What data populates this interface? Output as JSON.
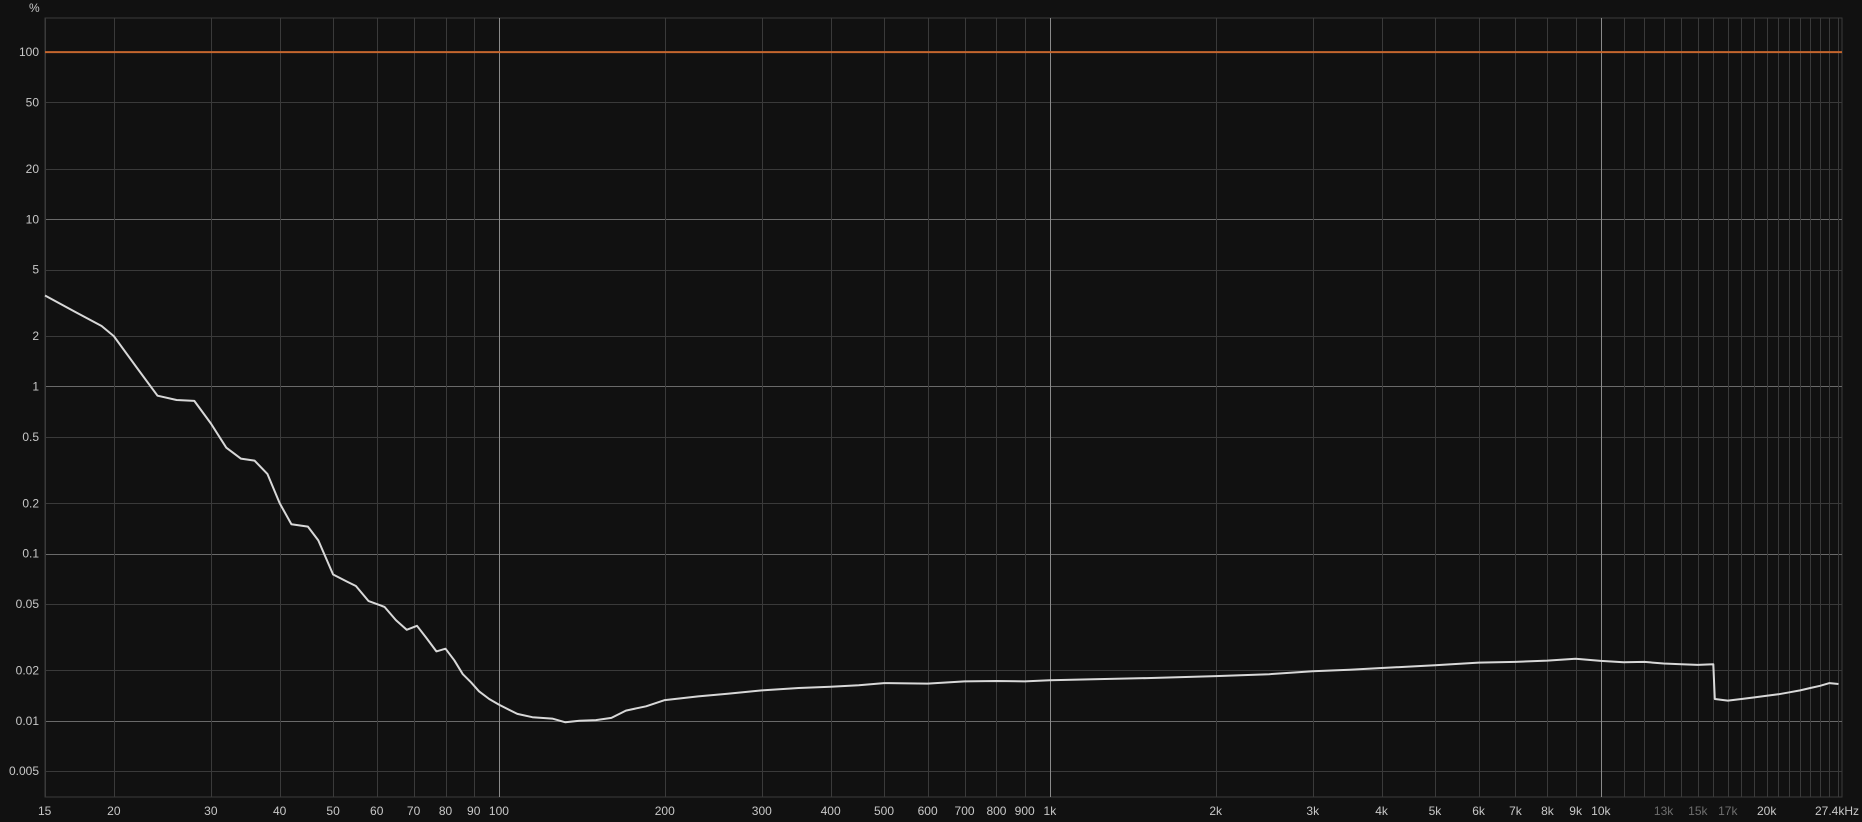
{
  "chart_data": {
    "type": "line",
    "y_unit_label": "%",
    "y_scale": "log",
    "x_scale": "log",
    "x_unit": "Hz",
    "xlim": [
      15,
      27400
    ],
    "ylim": [
      0.0035,
      160
    ],
    "grid": true,
    "colors": {
      "background": "#111111",
      "grid_major": "#6a6a6a",
      "grid_minor": "#3a3a3a",
      "reference_line": "#c4662e",
      "series": "#d8d8d8"
    },
    "y_ticks": [
      {
        "value": 100,
        "label": "100"
      },
      {
        "value": 50,
        "label": "50"
      },
      {
        "value": 20,
        "label": "20"
      },
      {
        "value": 10,
        "label": "10"
      },
      {
        "value": 5,
        "label": "5"
      },
      {
        "value": 2,
        "label": "2"
      },
      {
        "value": 1,
        "label": "1"
      },
      {
        "value": 0.5,
        "label": "0.5"
      },
      {
        "value": 0.2,
        "label": "0.2"
      },
      {
        "value": 0.1,
        "label": "0.1"
      },
      {
        "value": 0.05,
        "label": "0.05"
      },
      {
        "value": 0.02,
        "label": "0.02"
      },
      {
        "value": 0.01,
        "label": "0.01"
      },
      {
        "value": 0.005,
        "label": "0.005"
      }
    ],
    "x_ticks": [
      {
        "value": 15,
        "label": "15",
        "dim": false
      },
      {
        "value": 20,
        "label": "20",
        "dim": false
      },
      {
        "value": 30,
        "label": "30",
        "dim": false
      },
      {
        "value": 40,
        "label": "40",
        "dim": false
      },
      {
        "value": 50,
        "label": "50",
        "dim": false
      },
      {
        "value": 60,
        "label": "60",
        "dim": false
      },
      {
        "value": 70,
        "label": "70",
        "dim": false
      },
      {
        "value": 80,
        "label": "80",
        "dim": false
      },
      {
        "value": 90,
        "label": "90",
        "dim": false
      },
      {
        "value": 100,
        "label": "100",
        "dim": false
      },
      {
        "value": 200,
        "label": "200",
        "dim": false
      },
      {
        "value": 300,
        "label": "300",
        "dim": false
      },
      {
        "value": 400,
        "label": "400",
        "dim": false
      },
      {
        "value": 500,
        "label": "500",
        "dim": false
      },
      {
        "value": 600,
        "label": "600",
        "dim": false
      },
      {
        "value": 700,
        "label": "700",
        "dim": false
      },
      {
        "value": 800,
        "label": "800",
        "dim": false
      },
      {
        "value": 900,
        "label": "900",
        "dim": false
      },
      {
        "value": 1000,
        "label": "1k",
        "dim": false
      },
      {
        "value": 2000,
        "label": "2k",
        "dim": false
      },
      {
        "value": 3000,
        "label": "3k",
        "dim": false
      },
      {
        "value": 4000,
        "label": "4k",
        "dim": false
      },
      {
        "value": 5000,
        "label": "5k",
        "dim": false
      },
      {
        "value": 6000,
        "label": "6k",
        "dim": false
      },
      {
        "value": 7000,
        "label": "7k",
        "dim": false
      },
      {
        "value": 8000,
        "label": "8k",
        "dim": false
      },
      {
        "value": 9000,
        "label": "9k",
        "dim": false
      },
      {
        "value": 10000,
        "label": "10k",
        "dim": false
      },
      {
        "value": 13000,
        "label": "13k",
        "dim": true
      },
      {
        "value": 15000,
        "label": "15k",
        "dim": true
      },
      {
        "value": 17000,
        "label": "17k",
        "dim": true
      },
      {
        "value": 20000,
        "label": "20k",
        "dim": false
      },
      {
        "value": 27400,
        "label": "27.4kHz",
        "dim": false
      }
    ],
    "x_major_lines": [
      100,
      1000,
      10000
    ],
    "x_grid_lines": [
      15,
      20,
      30,
      40,
      50,
      60,
      70,
      80,
      90,
      100,
      200,
      300,
      400,
      500,
      600,
      700,
      800,
      900,
      1000,
      2000,
      3000,
      4000,
      5000,
      6000,
      7000,
      8000,
      9000,
      10000,
      11000,
      12000,
      13000,
      14000,
      15000,
      16000,
      17000,
      18000,
      19000,
      20000,
      21000,
      22000,
      23000,
      24000,
      25000,
      26000,
      27000
    ],
    "y_major_lines": [
      100,
      10,
      1,
      0.1,
      0.01
    ],
    "reference_series": {
      "value": 100
    },
    "series": [
      {
        "points": [
          [
            15,
            3.5
          ],
          [
            17,
            2.8
          ],
          [
            19,
            2.3
          ],
          [
            20,
            2.0
          ],
          [
            22,
            1.3
          ],
          [
            24,
            0.88
          ],
          [
            26,
            0.83
          ],
          [
            28,
            0.82
          ],
          [
            30,
            0.6
          ],
          [
            32,
            0.43
          ],
          [
            34,
            0.37
          ],
          [
            36,
            0.36
          ],
          [
            38,
            0.3
          ],
          [
            40,
            0.2
          ],
          [
            42,
            0.15
          ],
          [
            45,
            0.145
          ],
          [
            47,
            0.12
          ],
          [
            50,
            0.075
          ],
          [
            53,
            0.068
          ],
          [
            55,
            0.064
          ],
          [
            58,
            0.052
          ],
          [
            62,
            0.048
          ],
          [
            65,
            0.04
          ],
          [
            68,
            0.035
          ],
          [
            71,
            0.037
          ],
          [
            74,
            0.031
          ],
          [
            77,
            0.026
          ],
          [
            80,
            0.027
          ],
          [
            83,
            0.023
          ],
          [
            86,
            0.019
          ],
          [
            89,
            0.017
          ],
          [
            92,
            0.015
          ],
          [
            96,
            0.0135
          ],
          [
            100,
            0.0125
          ],
          [
            108,
            0.011
          ],
          [
            115,
            0.0105
          ],
          [
            125,
            0.0103
          ],
          [
            132,
            0.0098
          ],
          [
            140,
            0.01
          ],
          [
            150,
            0.0101
          ],
          [
            160,
            0.0104
          ],
          [
            170,
            0.0115
          ],
          [
            185,
            0.0122
          ],
          [
            200,
            0.0133
          ],
          [
            230,
            0.014
          ],
          [
            260,
            0.0145
          ],
          [
            300,
            0.0152
          ],
          [
            350,
            0.0157
          ],
          [
            400,
            0.016
          ],
          [
            450,
            0.0163
          ],
          [
            500,
            0.0168
          ],
          [
            600,
            0.0167
          ],
          [
            700,
            0.0172
          ],
          [
            800,
            0.0173
          ],
          [
            900,
            0.0172
          ],
          [
            1000,
            0.0175
          ],
          [
            1200,
            0.0177
          ],
          [
            1500,
            0.018
          ],
          [
            2000,
            0.0185
          ],
          [
            2500,
            0.019
          ],
          [
            3000,
            0.0198
          ],
          [
            3500,
            0.0202
          ],
          [
            4000,
            0.0207
          ],
          [
            5000,
            0.0215
          ],
          [
            6000,
            0.0223
          ],
          [
            7000,
            0.0225
          ],
          [
            8000,
            0.0229
          ],
          [
            9000,
            0.0235
          ],
          [
            10000,
            0.0228
          ],
          [
            11000,
            0.0224
          ],
          [
            12000,
            0.0225
          ],
          [
            13000,
            0.022
          ],
          [
            14000,
            0.0218
          ],
          [
            15000,
            0.0216
          ],
          [
            16000,
            0.0218
          ],
          [
            16100,
            0.0135
          ],
          [
            17000,
            0.0132
          ],
          [
            18000,
            0.0135
          ],
          [
            19000,
            0.0138
          ],
          [
            20000,
            0.0141
          ],
          [
            21000,
            0.0144
          ],
          [
            22000,
            0.0148
          ],
          [
            23000,
            0.0152
          ],
          [
            24000,
            0.0157
          ],
          [
            25000,
            0.0162
          ],
          [
            26000,
            0.0168
          ],
          [
            27000,
            0.0166
          ]
        ]
      }
    ]
  }
}
